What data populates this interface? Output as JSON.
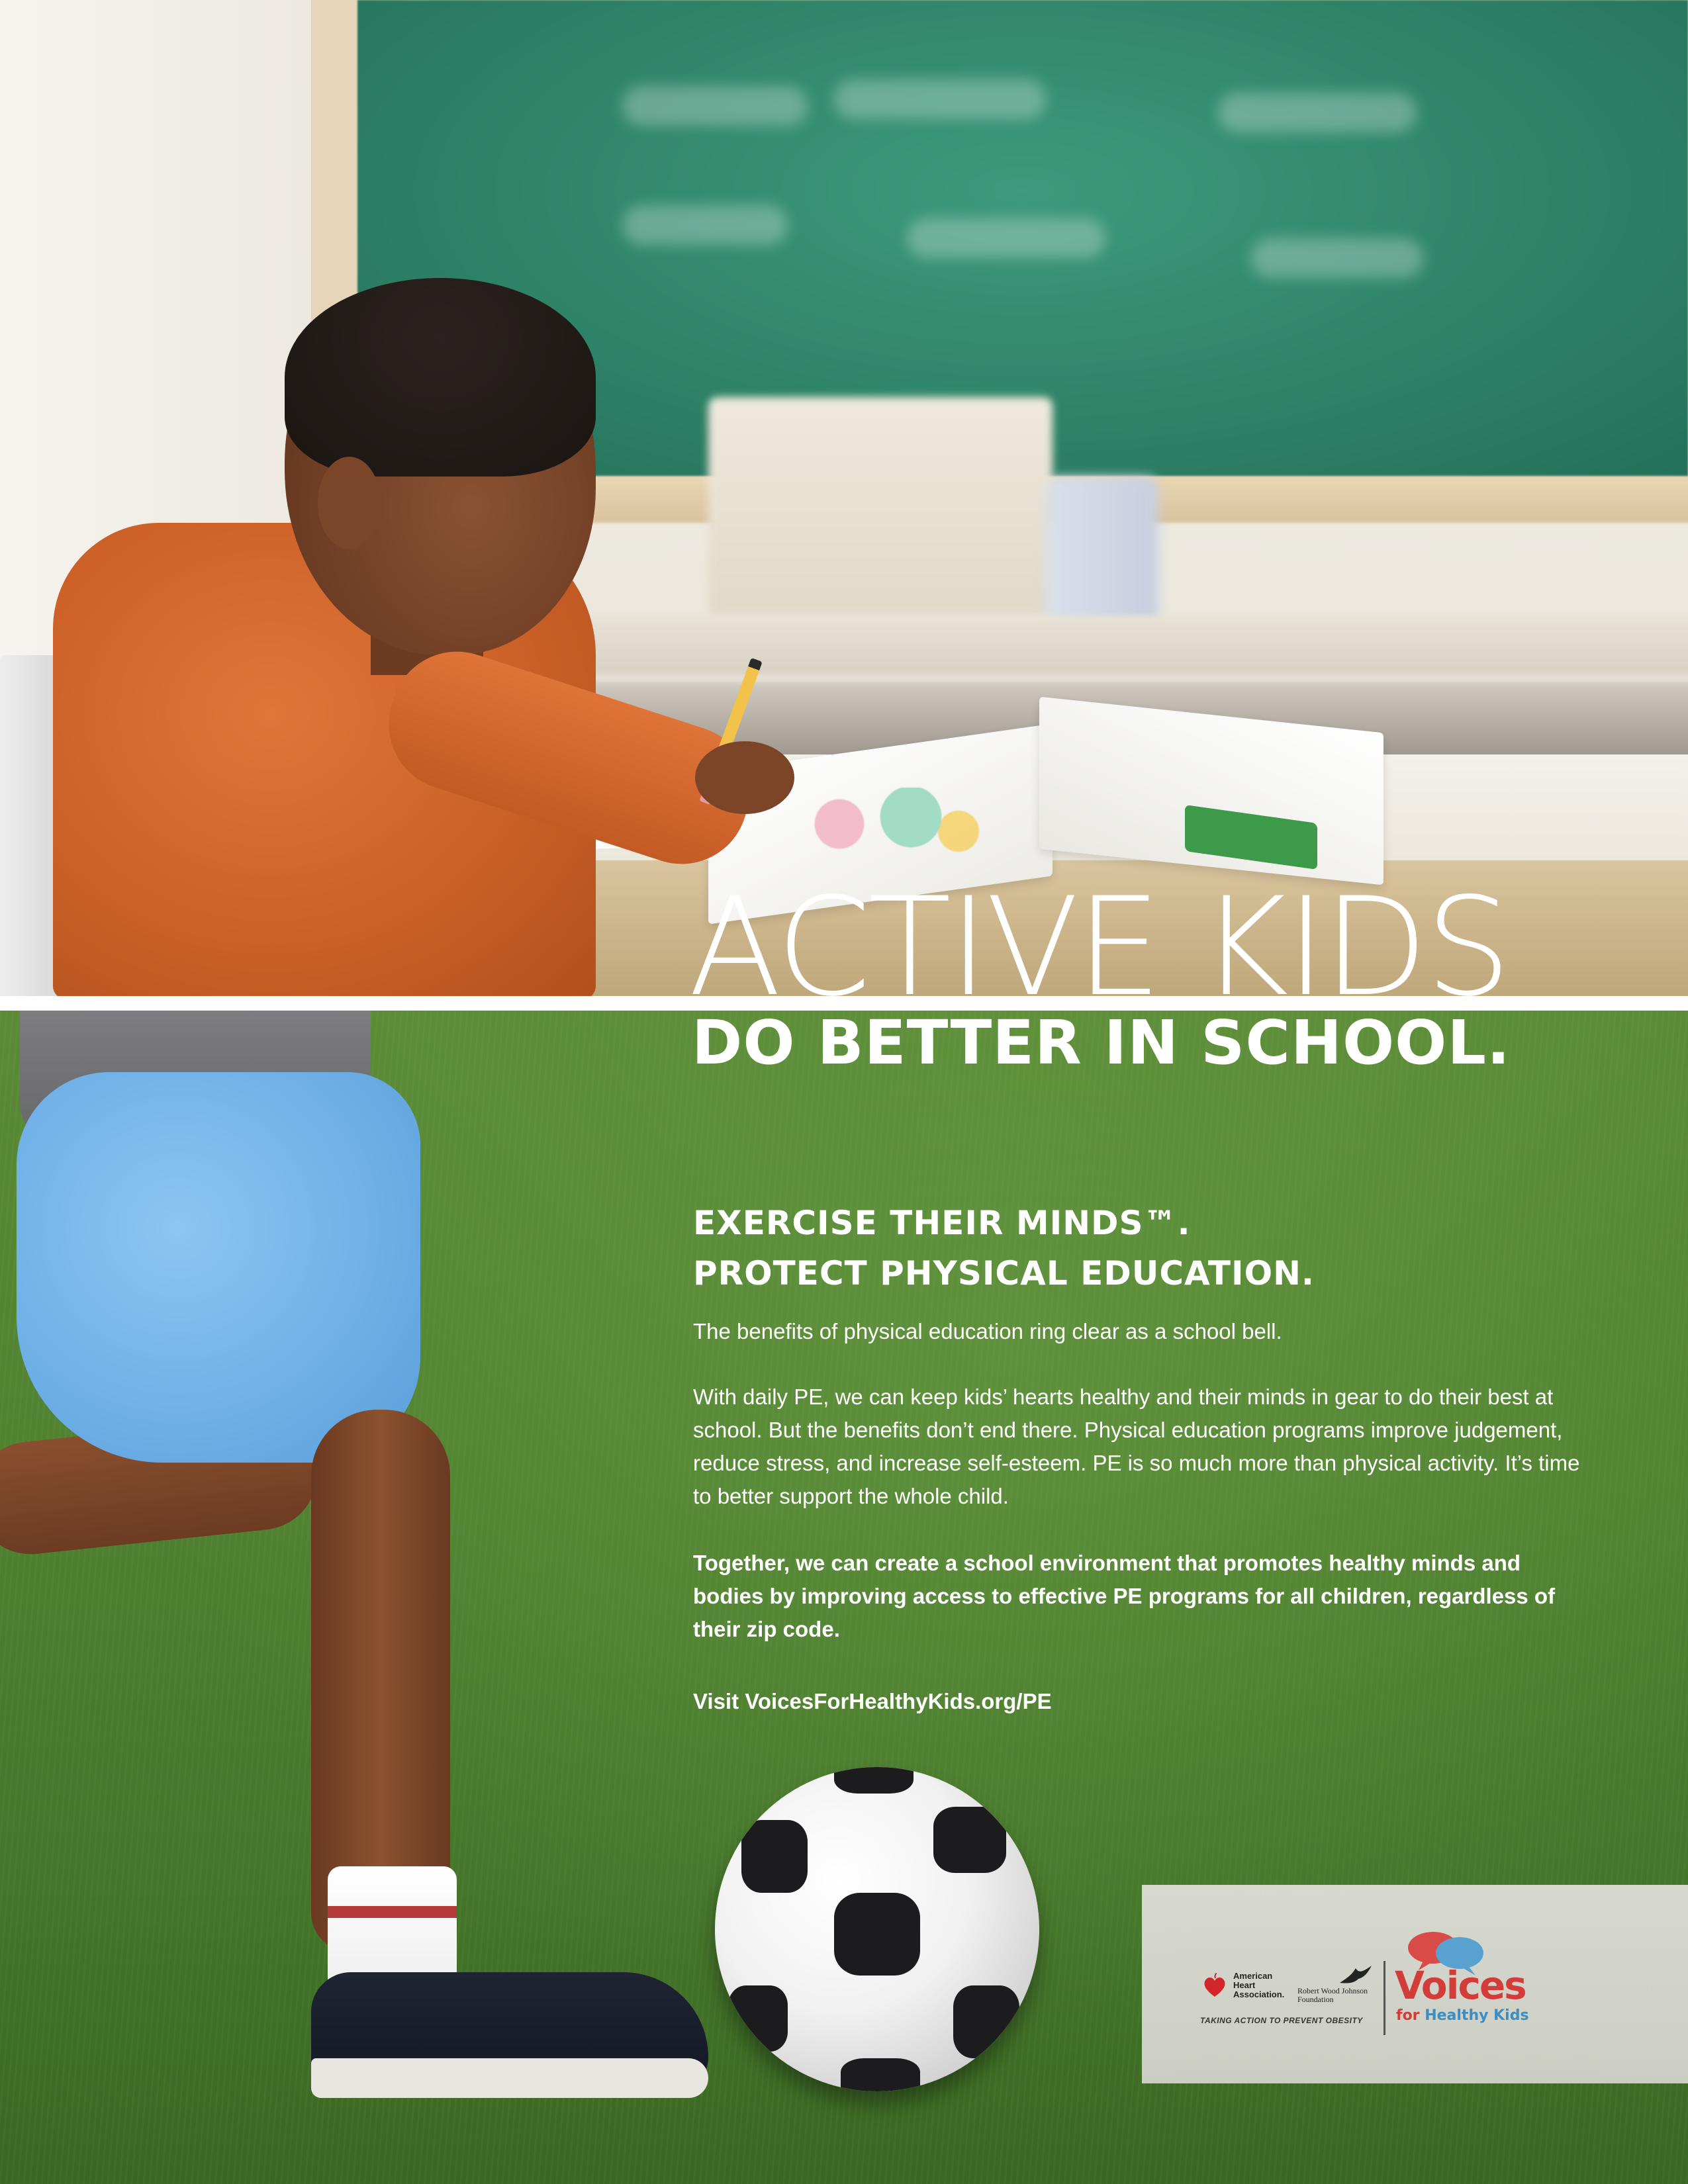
{
  "headline": {
    "main": "ACTIVE KIDS",
    "sub": "DO BETTER IN SCHOOL."
  },
  "subhead": {
    "line1": "EXERCISE THEIR MINDS™.",
    "line2": "PROTECT PHYSICAL EDUCATION."
  },
  "body": {
    "intro": "The benefits of physical education ring clear as a school bell.",
    "para1": "With daily PE, we can keep kids’ hearts healthy and their minds in gear to do their best at school. But the benefits don’t end there. Physical education programs improve judgement, reduce stress, and increase self-esteem. PE is so much more than physical activity. It’s time to better support the whole child.",
    "para2": "Together, we can create a school environment that promotes healthy minds and bodies by improving access to effective PE programs for all children, regardless of their zip code.",
    "visit": "Visit VoicesForHealthyKids.org/PE"
  },
  "logos": {
    "aha_line1": "American",
    "aha_line2": "Heart",
    "aha_line3": "Association.",
    "rwj_line1": "Robert Wood Johnson",
    "rwj_line2": "Foundation",
    "tagline": "TAKING ACTION TO PREVENT OBESITY",
    "voices_word": "Voices",
    "voices_for": "for",
    "voices_healthy_kids": "Healthy Kids"
  },
  "colors": {
    "aha_red": "#d8232a",
    "voices_red": "#d83a3a",
    "voices_blue": "#3d8fc7",
    "field_green": "#4f8130",
    "chalkboard_green": "#2f8468"
  },
  "icons": {
    "aha": "heart-torch-icon",
    "rwj": "eagle-icon",
    "voices": "speech-bubbles-icon"
  }
}
